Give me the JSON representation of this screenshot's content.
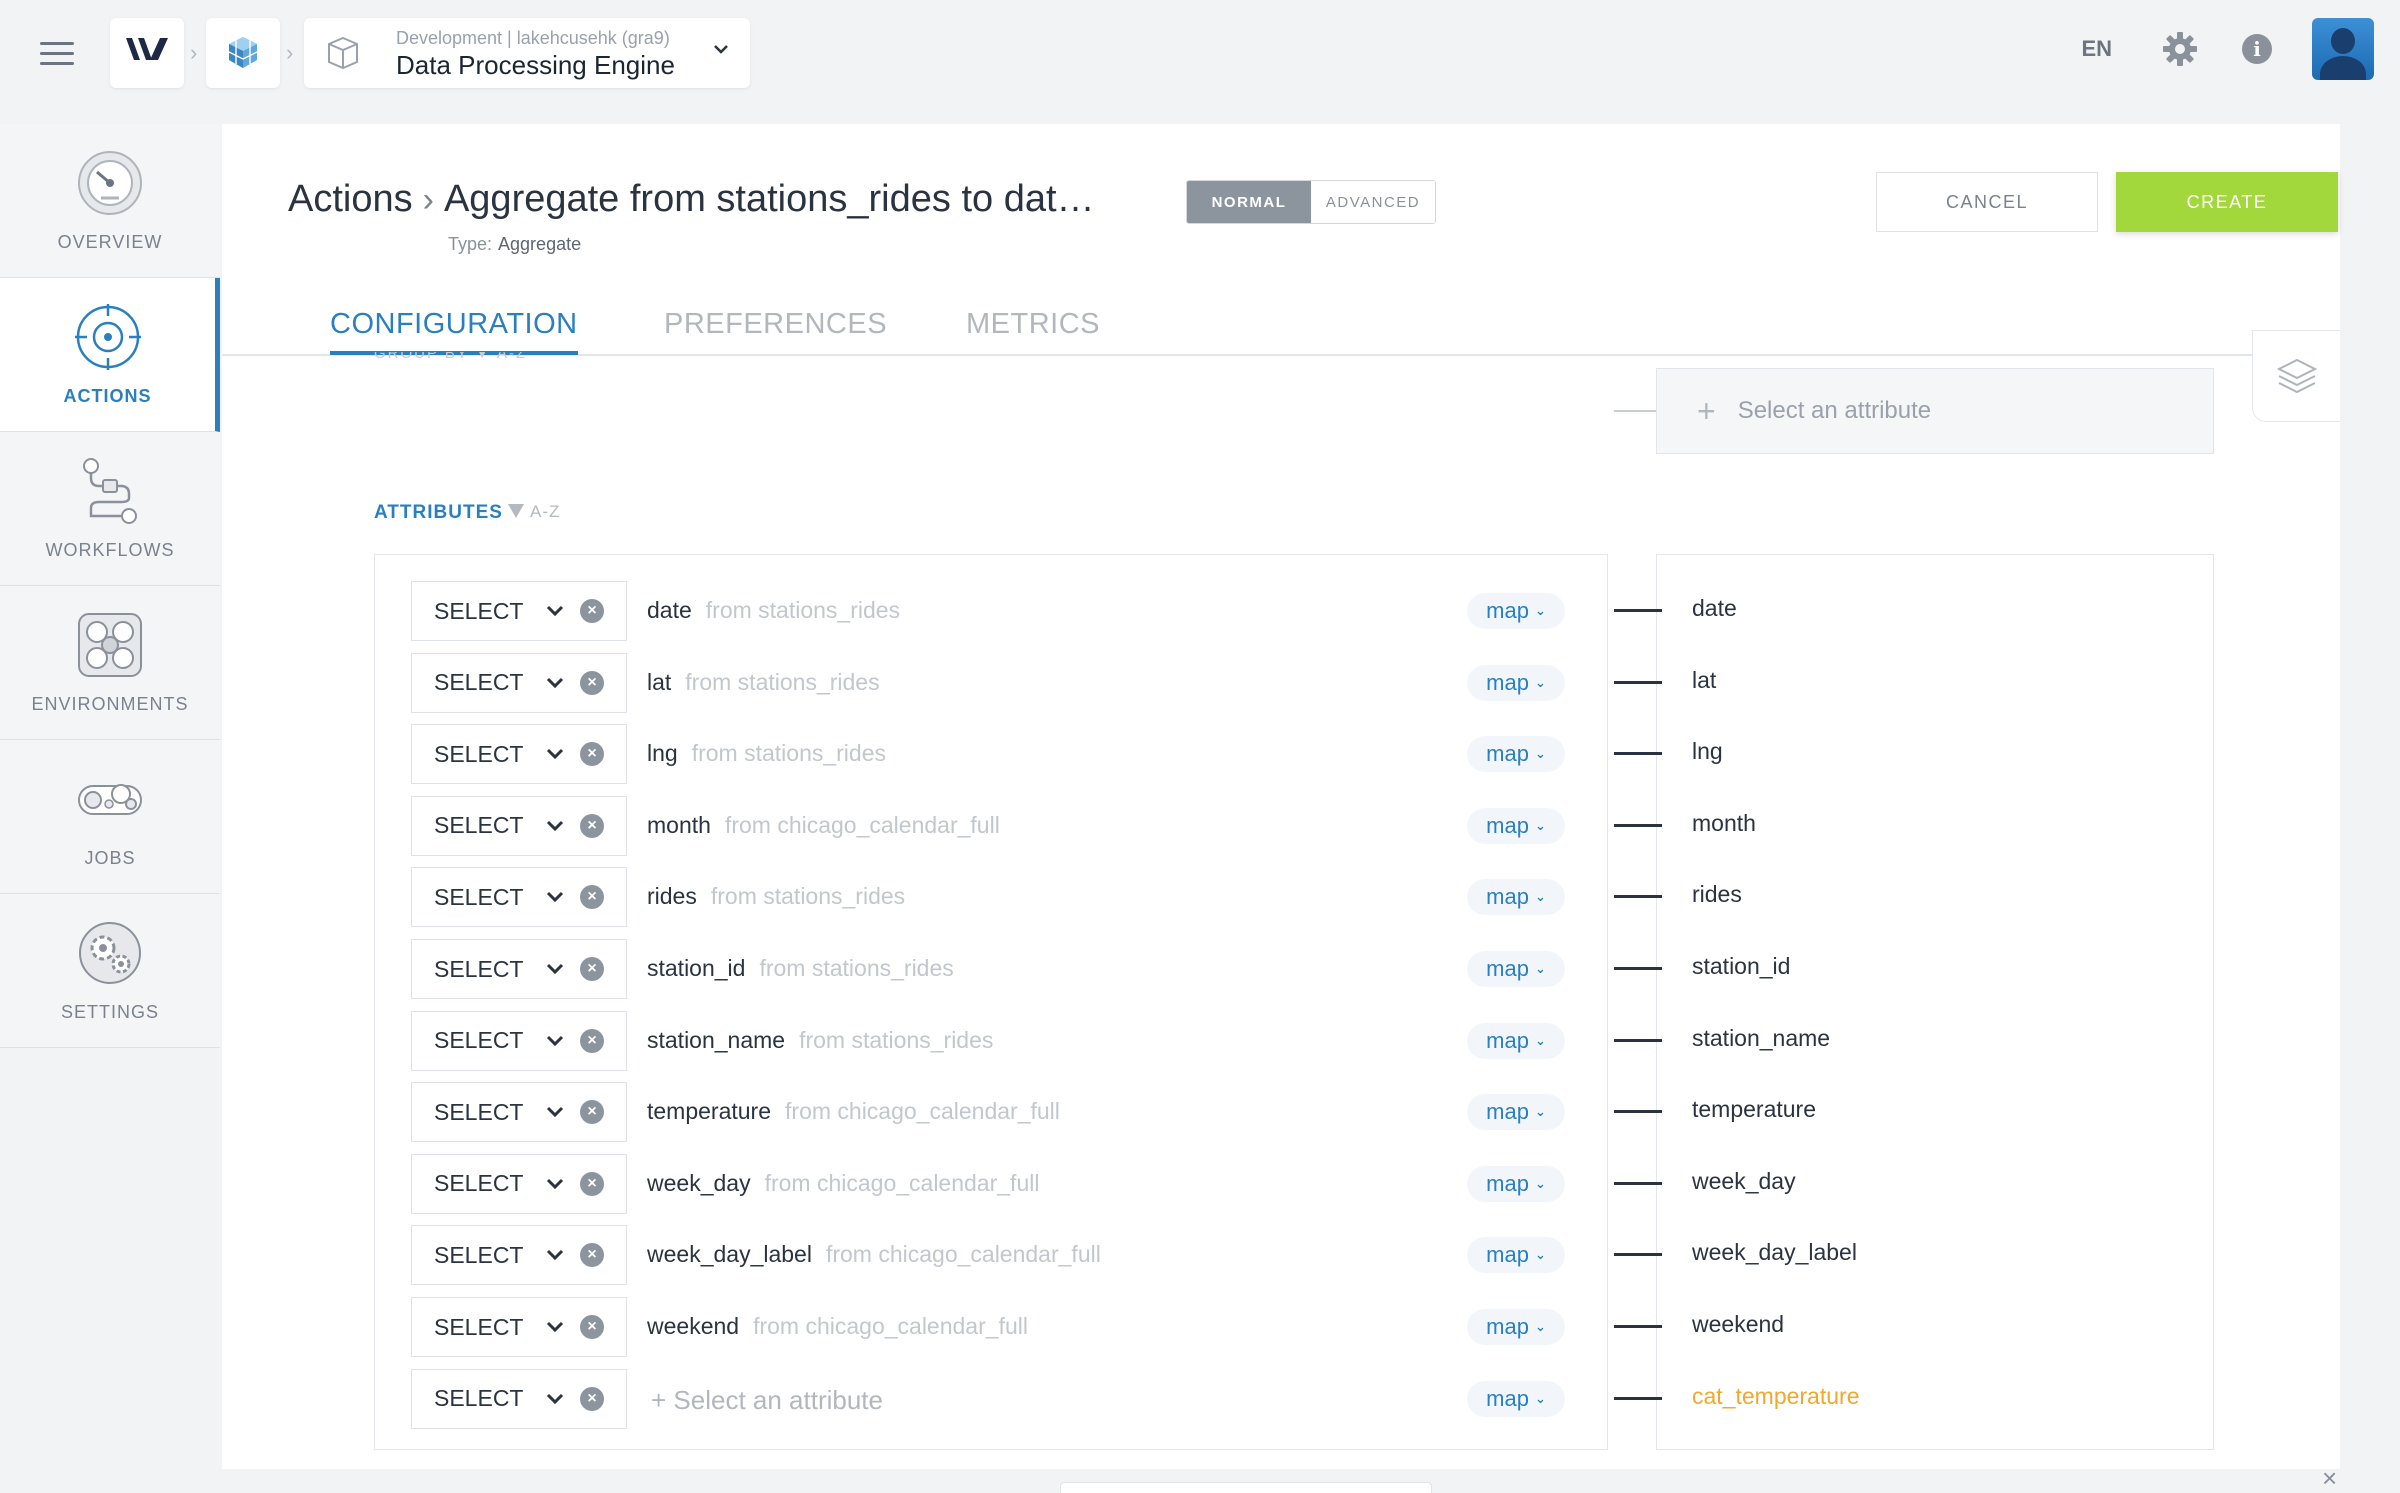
{
  "topbar": {
    "project_sub": "Development | lakehcusehk (gra9)",
    "project_title": "Data Processing Engine",
    "lang": "EN"
  },
  "sidebar": {
    "items": [
      {
        "label": "OVERVIEW",
        "icon": "speedometer-icon",
        "active": false
      },
      {
        "label": "ACTIONS",
        "icon": "target-icon",
        "active": true
      },
      {
        "label": "WORKFLOWS",
        "icon": "workflow-icon",
        "active": false
      },
      {
        "label": "ENVIRONMENTS",
        "icon": "environments-icon",
        "active": false
      },
      {
        "label": "JOBS",
        "icon": "jobs-icon",
        "active": false
      },
      {
        "label": "SETTINGS",
        "icon": "cogs-icon",
        "active": false
      }
    ]
  },
  "header": {
    "section": "Actions",
    "title": "Aggregate from stations_rides to dat…",
    "type_label": "Type:",
    "type_value": "Aggregate",
    "mode_normal": "NORMAL",
    "mode_advanced": "ADVANCED",
    "cancel_label": "CANCEL",
    "create_label": "CREATE"
  },
  "tabs": [
    {
      "label": "CONFIGURATION",
      "active": true
    },
    {
      "label": "PREFERENCES",
      "active": false
    },
    {
      "label": "METRICS",
      "active": false
    }
  ],
  "group_by": {
    "ghost_label": "GROUP BY  ▼ A-Z",
    "placeholder": "Select an attribute"
  },
  "attributes": {
    "heading": "ATTRIBUTES",
    "sort_label": "A-Z",
    "rows": [
      {
        "op": "SELECT",
        "name": "date",
        "from": "from stations_rides",
        "map": "map",
        "output": "date"
      },
      {
        "op": "SELECT",
        "name": "lat",
        "from": "from stations_rides",
        "map": "map",
        "output": "lat"
      },
      {
        "op": "SELECT",
        "name": "lng",
        "from": "from stations_rides",
        "map": "map",
        "output": "lng"
      },
      {
        "op": "SELECT",
        "name": "month",
        "from": "from chicago_calendar_full",
        "map": "map",
        "output": "month"
      },
      {
        "op": "SELECT",
        "name": "rides",
        "from": "from stations_rides",
        "map": "map",
        "output": "rides"
      },
      {
        "op": "SELECT",
        "name": "station_id",
        "from": "from stations_rides",
        "map": "map",
        "output": "station_id"
      },
      {
        "op": "SELECT",
        "name": "station_name",
        "from": "from stations_rides",
        "map": "map",
        "output": "station_name"
      },
      {
        "op": "SELECT",
        "name": "temperature",
        "from": "from chicago_calendar_full",
        "map": "map",
        "output": "temperature"
      },
      {
        "op": "SELECT",
        "name": "week_day",
        "from": "from chicago_calendar_full",
        "map": "map",
        "output": "week_day"
      },
      {
        "op": "SELECT",
        "name": "week_day_label",
        "from": "from chicago_calendar_full",
        "map": "map",
        "output": "week_day_label"
      },
      {
        "op": "SELECT",
        "name": "weekend",
        "from": "from chicago_calendar_full",
        "map": "map",
        "output": "weekend"
      }
    ],
    "new_row": {
      "op": "SELECT",
      "placeholder": "+ Select an attribute",
      "map": "map",
      "output": "cat_temperature"
    }
  },
  "colors": {
    "accent": "#2a7fc1",
    "create": "#a3d83c",
    "pending_output": "#f0a830"
  }
}
